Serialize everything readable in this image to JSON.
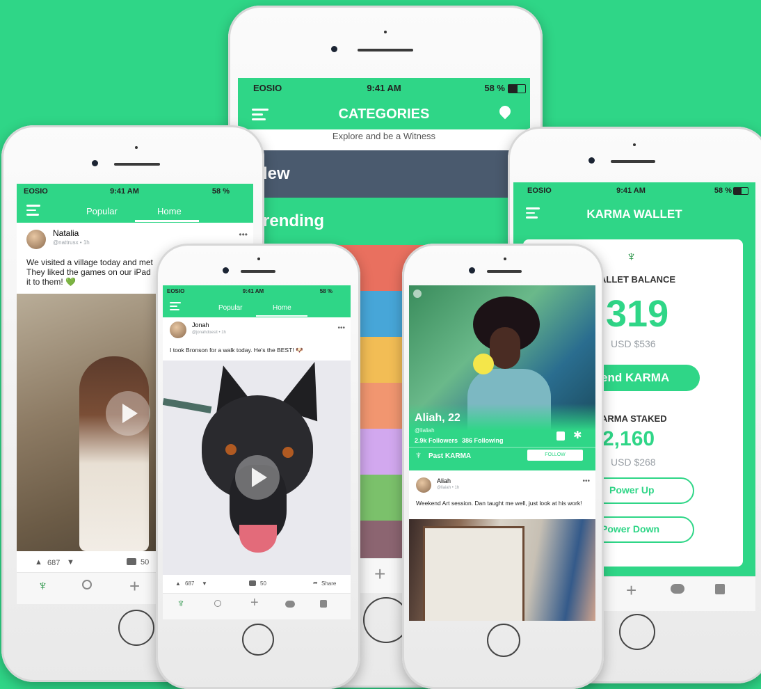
{
  "status": {
    "carrier": "EOSIO",
    "time": "9:41 AM",
    "battery": "58 %"
  },
  "categories_phone": {
    "title": "CATEGORIES",
    "subtitle": "Explore and be a Witness",
    "items": [
      "New",
      "Trending"
    ],
    "visible_items": [
      "lew",
      "rending"
    ],
    "swatch_colors": [
      "#e9705f",
      "#47a6d8",
      "#f2bd55",
      "#f19670",
      "#d2a8ef",
      "#7bc16b",
      "#8c6571"
    ],
    "header_color": "#2fd687",
    "row_color": "#4a5a6e"
  },
  "feed_phone_left": {
    "tabs": [
      "Popular",
      "Home"
    ],
    "author": "Natalia",
    "handle": "@nattrusx • 1h",
    "text_lines": [
      "We visited a village today and met",
      "They liked the games on our iPad",
      "it to them! 💚"
    ],
    "votes": "687",
    "comments": "50"
  },
  "feed_phone_mid": {
    "tabs": [
      "Popular",
      "Home"
    ],
    "author": "Jonah",
    "handle": "@jonahdoesit • 1h",
    "text": "I took Bronson for a walk today. He's the BEST! 🐶",
    "votes": "687",
    "comments": "50",
    "share": "Share"
  },
  "profile_phone": {
    "name": "Aliah, 22",
    "handle": "@lialiah",
    "followers": "2.9k Followers",
    "following": "386 Following",
    "past_karma": "Past KARMA",
    "follow": "FOLLOW",
    "post_author": "Aliah",
    "post_handle": "@liaiah • 1h",
    "post_text": "Weekend Art session. Dan taught me well, just look at his work!"
  },
  "wallet_phone": {
    "title": "KARMA WALLET",
    "balance_label": "ALLET BALANCE",
    "balance": ",319",
    "balance_usd": "USD $536",
    "send": "end KARMA",
    "staked_label": "ARMA STAKED",
    "staked": "2,160",
    "staked_usd": "USD $268",
    "power_up": "Power Up",
    "power_down": "Power Down"
  },
  "icons": {
    "menu": "hamburger-icon",
    "location": "map-pin-icon",
    "home": "leaf-logo-icon",
    "search": "search-icon",
    "add": "plus-icon",
    "chat": "chat-icon",
    "wallet": "wallet-icon"
  }
}
